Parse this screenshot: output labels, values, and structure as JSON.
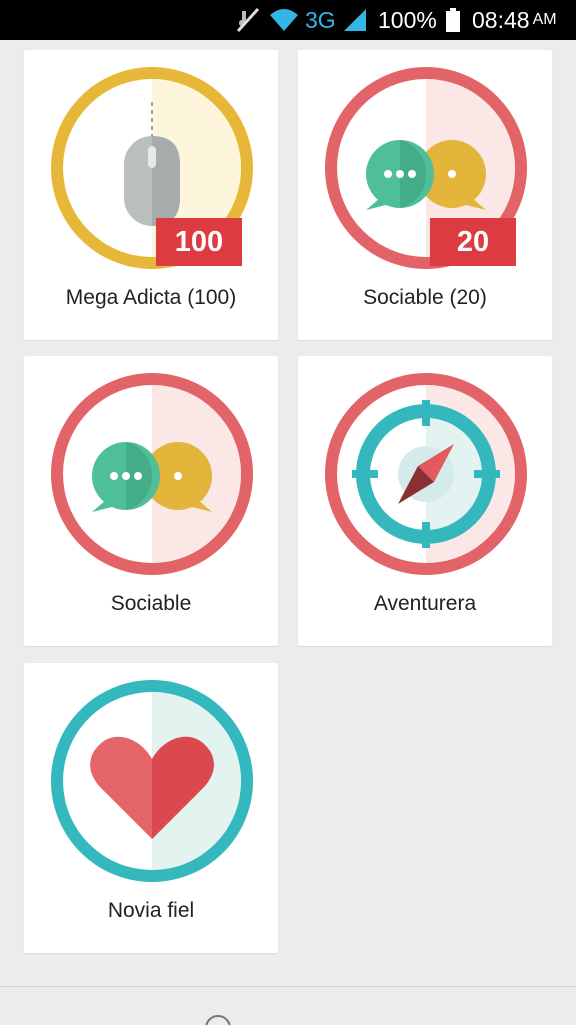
{
  "status_bar": {
    "network": "3G",
    "battery_percent": "100%",
    "time": "08:48",
    "ampm": "AM",
    "icons": [
      "mute-icon",
      "wifi-icon",
      "signal-icon",
      "battery-icon"
    ]
  },
  "badges": [
    {
      "label": "Mega Adicta (100)",
      "count": "100",
      "icon": "mouse-icon",
      "ring_color": "#e7b73a"
    },
    {
      "label": "Sociable (20)",
      "count": "20",
      "icon": "chat-bubbles-icon",
      "ring_color": "#e36468"
    },
    {
      "label": "Sociable",
      "icon": "chat-bubbles-icon",
      "ring_color": "#e36468"
    },
    {
      "label": "Aventurera",
      "icon": "compass-icon",
      "ring_color": "#e36468"
    },
    {
      "label": "Novia fiel",
      "icon": "heart-icon",
      "ring_color": "#34b8bd"
    }
  ],
  "colors": {
    "badge_count_bg": "#dc3b41",
    "teal": "#34b8bd",
    "green_chat": "#4fbf98",
    "yellow_chat": "#e3b53b"
  }
}
